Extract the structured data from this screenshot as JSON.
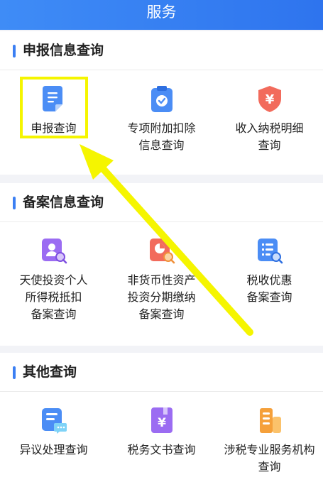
{
  "header": {
    "title": "服务"
  },
  "sections": [
    {
      "title": "申报信息查询",
      "items": [
        {
          "label": "申报查询",
          "icon": "document-icon"
        },
        {
          "label": "专项附加扣除\n信息查询",
          "icon": "clipboard-check-icon"
        },
        {
          "label": "收入纳税明细\n查询",
          "icon": "yuan-shield-icon"
        }
      ]
    },
    {
      "title": "备案信息查询",
      "items": [
        {
          "label": "天使投资个人\n所得税抵扣\n备案查询",
          "icon": "person-search-icon"
        },
        {
          "label": "非货币性资产\n投资分期缴纳\n备案查询",
          "icon": "chart-search-icon"
        },
        {
          "label": "税收优惠\n备案查询",
          "icon": "list-search-icon"
        }
      ]
    },
    {
      "title": "其他查询",
      "items": [
        {
          "label": "异议处理查询",
          "icon": "message-doc-icon"
        },
        {
          "label": "税务文书查询",
          "icon": "yuan-book-icon"
        },
        {
          "label": "涉税专业服务机构\n查询",
          "icon": "building-icon"
        }
      ]
    }
  ],
  "colors": {
    "accent": "#3b7ff3",
    "highlight": "#f5f500"
  }
}
